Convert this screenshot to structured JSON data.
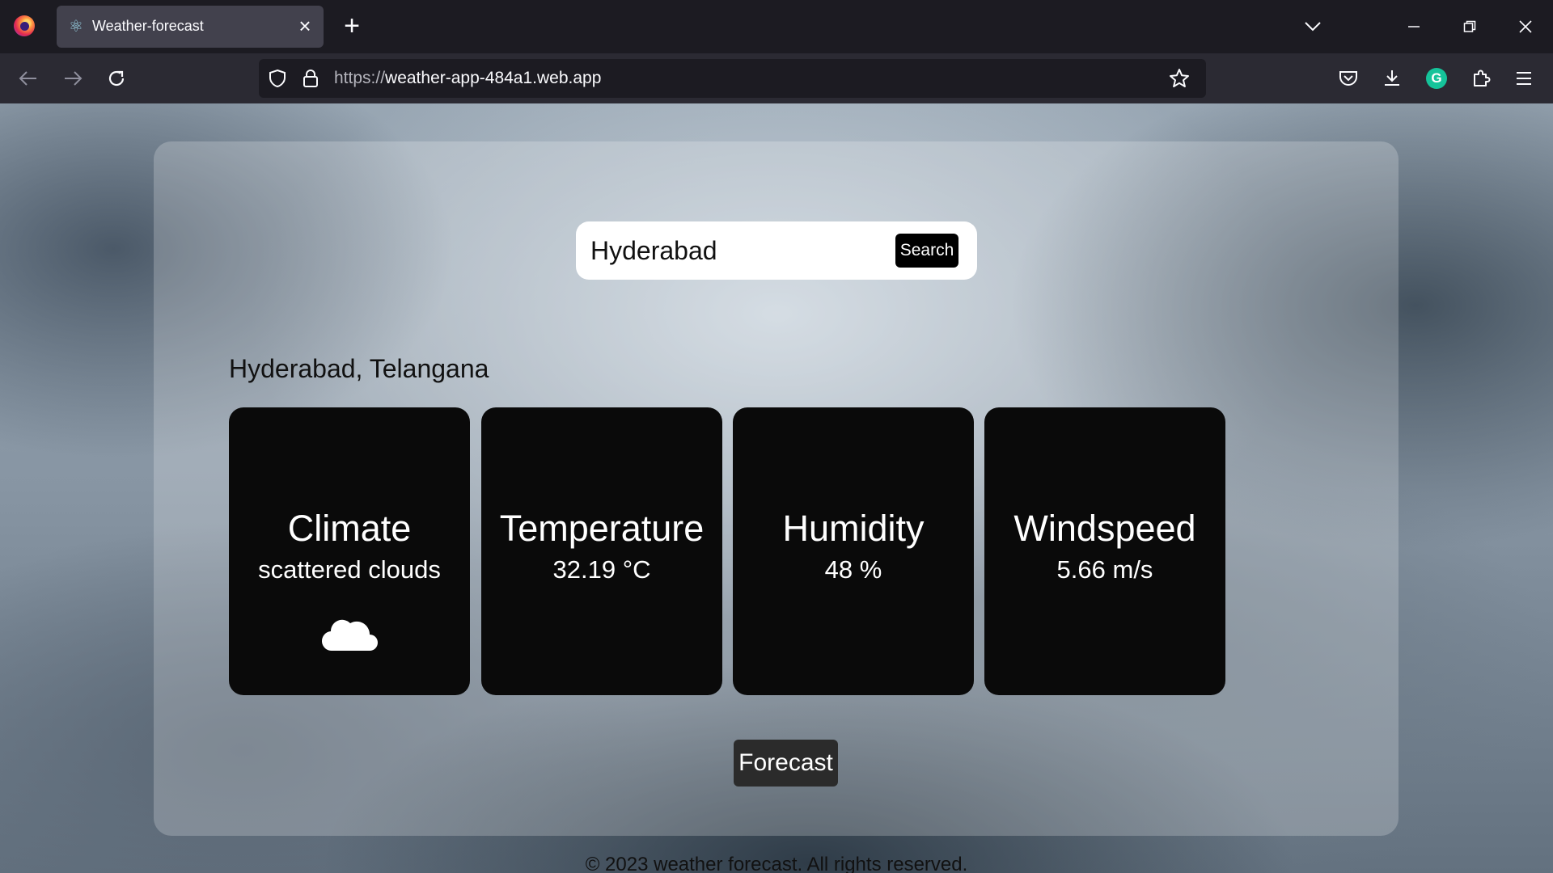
{
  "browser": {
    "tab_title": "Weather-forecast",
    "url_protocol": "https://",
    "url_host": "weather-app-484a1.web.app",
    "icons": {
      "tab": "react-icon",
      "close": "close-icon",
      "new_tab": "plus-icon",
      "tab_list": "chevron-down-icon",
      "minimize": "minimize-icon",
      "restore": "restore-icon",
      "window_close": "close-icon",
      "back": "back-arrow-icon",
      "forward": "forward-arrow-icon",
      "reload": "reload-icon",
      "shield": "shield-icon",
      "lock": "lock-icon",
      "bookmark": "star-icon",
      "pocket": "pocket-icon",
      "downloads": "download-icon",
      "grammarly": "grammarly-icon",
      "extensions": "puzzle-icon",
      "menu": "hamburger-menu-icon"
    },
    "grammarly_letter": "G"
  },
  "search": {
    "value": "Hyderabad",
    "button_label": "Search"
  },
  "location": "Hyderabad, Telangana",
  "cards": [
    {
      "title": "Climate",
      "value": "scattered clouds",
      "icon": "cloud-icon"
    },
    {
      "title": "Temperature",
      "value": "32.19 °C"
    },
    {
      "title": "Humidity",
      "value": "48 %"
    },
    {
      "title": "Windspeed",
      "value": "5.66 m/s"
    }
  ],
  "forecast_button": "Forecast",
  "footer": "© 2023 weather forecast. All rights reserved."
}
